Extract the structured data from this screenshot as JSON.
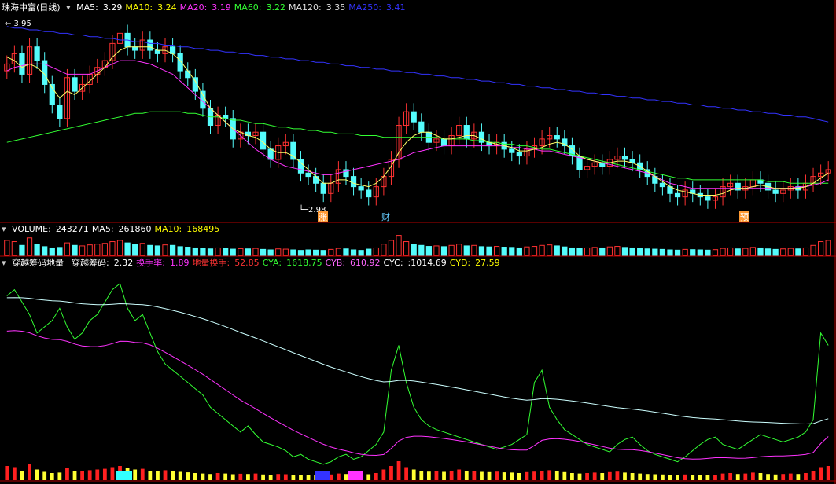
{
  "panels": {
    "price": {
      "title": "珠海中富(日线)",
      "indicators": [
        {
          "label": "MA5:",
          "value": "3.29",
          "color": "#ffffff"
        },
        {
          "label": "MA10:",
          "value": "3.24",
          "color": "#ffff00"
        },
        {
          "label": "MA20:",
          "value": "3.19",
          "color": "#ff33ff"
        },
        {
          "label": "MA60:",
          "value": "3.22",
          "color": "#33ff33"
        },
        {
          "label": "MA120:",
          "value": "3.35",
          "color": "#dddddd"
        },
        {
          "label": "MA250:",
          "value": "3.41",
          "color": "#3333ff"
        }
      ],
      "high_label": "3.95",
      "low_label": "2.98",
      "markers": [
        {
          "text": "涨",
          "bg": "#ff9933",
          "fg": "#ffffff"
        },
        {
          "text": "财",
          "bg": "",
          "fg": "#66ccff"
        },
        {
          "text": "预",
          "bg": "#ff9933",
          "fg": "#ffffff"
        }
      ]
    },
    "volume": {
      "indicators": [
        {
          "label": "VOLUME:",
          "value": "243271",
          "color": "#ffffff"
        },
        {
          "label": "MA5:",
          "value": "261860",
          "color": "#ffffff"
        },
        {
          "label": "MA10:",
          "value": "168495",
          "color": "#ffff00"
        }
      ]
    },
    "indicator": {
      "indicators": [
        {
          "label": "穿越筹码地量",
          "value": "",
          "color": "#ffffff"
        },
        {
          "label": "穿越筹码:",
          "value": "2.32",
          "color": "#ffffff"
        },
        {
          "label": "换手率:",
          "value": "1.89",
          "color": "#ff33ff"
        },
        {
          "label": "地量换手:",
          "value": "52.85",
          "color": "#ff3333"
        },
        {
          "label": "CYA:",
          "value": "1618.75",
          "color": "#33ff33"
        },
        {
          "label": "CYB:",
          "value": "610.92",
          "color": "#ff66ff"
        },
        {
          "label": "CYC:",
          "value": ":1014.69",
          "color": "#ffffff"
        },
        {
          "label": "CYD:",
          "value": "27.59",
          "color": "#ffff00"
        }
      ]
    }
  },
  "chart_data": {
    "type": "line",
    "close": [
      3.76,
      3.82,
      3.7,
      3.86,
      3.78,
      3.64,
      3.52,
      3.44,
      3.68,
      3.6,
      3.64,
      3.7,
      3.74,
      3.78,
      3.88,
      3.94,
      3.86,
      3.84,
      3.9,
      3.84,
      3.82,
      3.86,
      3.82,
      3.72,
      3.68,
      3.6,
      3.5,
      3.4,
      3.46,
      3.44,
      3.32,
      3.36,
      3.34,
      3.36,
      3.26,
      3.2,
      3.28,
      3.3,
      3.2,
      3.12,
      3.1,
      3.06,
      3.0,
      3.06,
      3.14,
      3.1,
      3.04,
      3.02,
      2.98,
      3.04,
      3.1,
      3.2,
      3.4,
      3.48,
      3.42,
      3.36,
      3.3,
      3.32,
      3.28,
      3.34,
      3.4,
      3.32,
      3.36,
      3.3,
      3.28,
      3.3,
      3.26,
      3.24,
      3.22,
      3.26,
      3.28,
      3.32,
      3.34,
      3.32,
      3.28,
      3.22,
      3.14,
      3.16,
      3.18,
      3.16,
      3.2,
      3.22,
      3.2,
      3.18,
      3.14,
      3.1,
      3.06,
      3.04,
      3.0,
      2.98,
      3.02,
      3.0,
      2.98,
      2.96,
      2.98,
      3.04,
      3.06,
      3.02,
      3.04,
      3.08,
      3.06,
      3.02,
      3.0,
      3.02,
      3.04,
      3.02,
      3.06,
      3.1,
      3.12,
      3.14
    ],
    "ma5": [
      3.8,
      3.78,
      3.74,
      3.76,
      3.74,
      3.7,
      3.62,
      3.56,
      3.6,
      3.58,
      3.62,
      3.66,
      3.7,
      3.74,
      3.8,
      3.84,
      3.86,
      3.86,
      3.86,
      3.86,
      3.84,
      3.84,
      3.82,
      3.78,
      3.72,
      3.66,
      3.58,
      3.5,
      3.46,
      3.42,
      3.38,
      3.36,
      3.34,
      3.33,
      3.3,
      3.26,
      3.24,
      3.24,
      3.22,
      3.18,
      3.14,
      3.1,
      3.06,
      3.06,
      3.08,
      3.08,
      3.06,
      3.05,
      3.04,
      3.06,
      3.1,
      3.16,
      3.24,
      3.3,
      3.34,
      3.36,
      3.36,
      3.34,
      3.32,
      3.32,
      3.33,
      3.34,
      3.34,
      3.32,
      3.3,
      3.29,
      3.28,
      3.27,
      3.25,
      3.25,
      3.26,
      3.27,
      3.29,
      3.3,
      3.29,
      3.26,
      3.22,
      3.2,
      3.19,
      3.18,
      3.18,
      3.19,
      3.19,
      3.18,
      3.16,
      3.13,
      3.1,
      3.07,
      3.04,
      3.02,
      3.01,
      3.0,
      2.99,
      2.99,
      2.99,
      3.0,
      3.02,
      3.03,
      3.03,
      3.04,
      3.05,
      3.04,
      3.03,
      3.03,
      3.03,
      3.03,
      3.04,
      3.06,
      3.09,
      3.12
    ],
    "ma20": [
      3.72,
      3.74,
      3.75,
      3.76,
      3.76,
      3.76,
      3.74,
      3.72,
      3.7,
      3.7,
      3.7,
      3.7,
      3.72,
      3.74,
      3.76,
      3.78,
      3.78,
      3.78,
      3.77,
      3.76,
      3.74,
      3.72,
      3.7,
      3.66,
      3.62,
      3.58,
      3.54,
      3.5,
      3.46,
      3.42,
      3.38,
      3.34,
      3.3,
      3.26,
      3.23,
      3.2,
      3.18,
      3.16,
      3.15,
      3.14,
      3.13,
      3.12,
      3.11,
      3.11,
      3.12,
      3.13,
      3.14,
      3.15,
      3.16,
      3.17,
      3.18,
      3.19,
      3.2,
      3.22,
      3.24,
      3.25,
      3.26,
      3.27,
      3.28,
      3.28,
      3.28,
      3.28,
      3.28,
      3.28,
      3.28,
      3.28,
      3.28,
      3.27,
      3.27,
      3.26,
      3.26,
      3.25,
      3.25,
      3.24,
      3.23,
      3.22,
      3.21,
      3.2,
      3.19,
      3.18,
      3.17,
      3.16,
      3.15,
      3.14,
      3.13,
      3.12,
      3.1,
      3.08,
      3.06,
      3.05,
      3.04,
      3.03,
      3.03,
      3.03,
      3.03,
      3.03,
      3.03,
      3.03,
      3.03,
      3.03,
      3.03,
      3.03,
      3.03,
      3.03,
      3.03,
      3.04,
      3.04,
      3.05,
      3.06,
      3.08
    ],
    "ma60": [
      3.3,
      3.31,
      3.32,
      3.33,
      3.34,
      3.35,
      3.36,
      3.37,
      3.38,
      3.39,
      3.4,
      3.41,
      3.42,
      3.43,
      3.44,
      3.45,
      3.46,
      3.47,
      3.47,
      3.48,
      3.48,
      3.48,
      3.48,
      3.48,
      3.47,
      3.47,
      3.46,
      3.45,
      3.45,
      3.44,
      3.43,
      3.43,
      3.42,
      3.41,
      3.41,
      3.4,
      3.39,
      3.39,
      3.38,
      3.38,
      3.37,
      3.37,
      3.36,
      3.36,
      3.35,
      3.35,
      3.35,
      3.34,
      3.34,
      3.34,
      3.33,
      3.33,
      3.33,
      3.33,
      3.33,
      3.33,
      3.33,
      3.33,
      3.32,
      3.32,
      3.32,
      3.32,
      3.31,
      3.31,
      3.3,
      3.3,
      3.29,
      3.29,
      3.28,
      3.28,
      3.27,
      3.26,
      3.26,
      3.25,
      3.24,
      3.23,
      3.22,
      3.21,
      3.2,
      3.19,
      3.18,
      3.17,
      3.16,
      3.15,
      3.14,
      3.13,
      3.12,
      3.11,
      3.1,
      3.09,
      3.09,
      3.08,
      3.08,
      3.08,
      3.08,
      3.08,
      3.08,
      3.08,
      3.08,
      3.08,
      3.08,
      3.07,
      3.07,
      3.07,
      3.06,
      3.06,
      3.06,
      3.06,
      3.06,
      3.06
    ],
    "ma250": [
      3.98,
      3.97,
      3.97,
      3.96,
      3.96,
      3.95,
      3.95,
      3.94,
      3.94,
      3.93,
      3.93,
      3.92,
      3.92,
      3.91,
      3.91,
      3.9,
      3.9,
      3.89,
      3.89,
      3.88,
      3.88,
      3.87,
      3.87,
      3.86,
      3.86,
      3.85,
      3.85,
      3.84,
      3.84,
      3.83,
      3.83,
      3.82,
      3.82,
      3.81,
      3.81,
      3.8,
      3.8,
      3.79,
      3.79,
      3.78,
      3.78,
      3.77,
      3.77,
      3.76,
      3.76,
      3.75,
      3.75,
      3.74,
      3.74,
      3.73,
      3.73,
      3.72,
      3.72,
      3.71,
      3.71,
      3.7,
      3.7,
      3.69,
      3.69,
      3.68,
      3.68,
      3.67,
      3.67,
      3.66,
      3.66,
      3.65,
      3.65,
      3.64,
      3.64,
      3.63,
      3.63,
      3.62,
      3.62,
      3.61,
      3.61,
      3.6,
      3.6,
      3.59,
      3.59,
      3.58,
      3.58,
      3.57,
      3.57,
      3.56,
      3.56,
      3.55,
      3.55,
      3.54,
      3.54,
      3.53,
      3.53,
      3.52,
      3.52,
      3.51,
      3.51,
      3.5,
      3.5,
      3.49,
      3.49,
      3.48,
      3.48,
      3.47,
      3.47,
      3.46,
      3.46,
      3.45,
      3.45,
      3.44,
      3.43,
      3.42
    ],
    "volume": [
      60,
      55,
      40,
      70,
      45,
      35,
      30,
      32,
      50,
      40,
      38,
      42,
      45,
      48,
      55,
      60,
      50,
      45,
      48,
      40,
      38,
      42,
      40,
      35,
      33,
      30,
      28,
      26,
      30,
      28,
      25,
      27,
      26,
      28,
      24,
      22,
      26,
      25,
      22,
      20,
      22,
      21,
      20,
      24,
      28,
      26,
      22,
      20,
      25,
      30,
      45,
      60,
      80,
      55,
      45,
      40,
      36,
      38,
      35,
      40,
      45,
      38,
      40,
      35,
      34,
      36,
      33,
      32,
      30,
      34,
      36,
      40,
      42,
      38,
      34,
      30,
      28,
      30,
      32,
      30,
      34,
      36,
      32,
      30,
      28,
      26,
      25,
      24,
      22,
      21,
      24,
      23,
      22,
      21,
      23,
      28,
      30,
      26,
      28,
      32,
      30,
      26,
      24,
      26,
      28,
      26,
      30,
      40,
      55,
      60
    ],
    "cya": [
      1900,
      1950,
      1850,
      1750,
      1600,
      1650,
      1700,
      1800,
      1650,
      1550,
      1600,
      1700,
      1750,
      1850,
      1950,
      2000,
      1800,
      1700,
      1750,
      1600,
      1450,
      1350,
      1300,
      1250,
      1200,
      1150,
      1100,
      1000,
      950,
      900,
      850,
      800,
      850,
      780,
      720,
      700,
      680,
      650,
      600,
      620,
      580,
      560,
      540,
      560,
      600,
      620,
      580,
      600,
      650,
      700,
      800,
      1300,
      1500,
      1200,
      1000,
      900,
      850,
      820,
      800,
      780,
      760,
      740,
      720,
      700,
      680,
      660,
      680,
      700,
      740,
      780,
      1200,
      1300,
      1000,
      900,
      820,
      780,
      740,
      700,
      680,
      660,
      640,
      700,
      740,
      760,
      700,
      650,
      620,
      600,
      580,
      560,
      600,
      650,
      700,
      740,
      760,
      700,
      680,
      660,
      700,
      740,
      780,
      760,
      740,
      720,
      740,
      760,
      800,
      900,
      1600,
      1500
    ]
  }
}
